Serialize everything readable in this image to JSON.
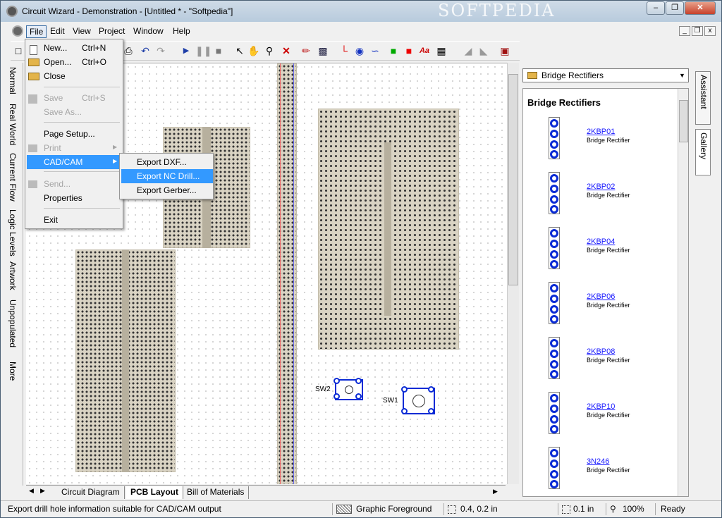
{
  "window": {
    "title": "Circuit Wizard - Demonstration - [Untitled * - \"Softpedia\"]",
    "watermark": "SOFTPEDIA"
  },
  "menubar": [
    "File",
    "Edit",
    "View",
    "Project",
    "Window",
    "Help"
  ],
  "file_menu": {
    "new": "New...",
    "new_sc": "Ctrl+N",
    "open": "Open...",
    "open_sc": "Ctrl+O",
    "close": "Close",
    "save": "Save",
    "save_sc": "Ctrl+S",
    "save_as": "Save As...",
    "page_setup": "Page Setup...",
    "print": "Print",
    "cadcam": "CAD/CAM",
    "send": "Send...",
    "properties": "Properties",
    "exit": "Exit"
  },
  "cadcam_menu": {
    "export_dxf": "Export DXF...",
    "export_nc_drill": "Export NC Drill...",
    "export_gerber": "Export Gerber..."
  },
  "side_tabs": [
    "Normal",
    "Real World",
    "Current Flow",
    "Logic Levels",
    "Artwork",
    "Unpopulated",
    "More"
  ],
  "canvas": {
    "sw1": "SW1",
    "sw2": "SW2"
  },
  "doc_tabs": [
    "Circuit Diagram",
    "PCB Layout",
    "Bill of Materials"
  ],
  "gallery": {
    "combo_value": "Bridge Rectifiers",
    "heading": "Bridge Rectifiers",
    "items": [
      {
        "name": "2KBP01",
        "desc": "Bridge Rectifier"
      },
      {
        "name": "2KBP02",
        "desc": "Bridge Rectifier"
      },
      {
        "name": "2KBP04",
        "desc": "Bridge Rectifier"
      },
      {
        "name": "2KBP06",
        "desc": "Bridge Rectifier"
      },
      {
        "name": "2KBP08",
        "desc": "Bridge Rectifier"
      },
      {
        "name": "2KBP10",
        "desc": "Bridge Rectifier"
      },
      {
        "name": "3N246",
        "desc": "Bridge Rectifier"
      }
    ]
  },
  "right_tabs": [
    "Assistant",
    "Gallery"
  ],
  "statusbar": {
    "message": "Export drill hole information suitable for CAD/CAM output",
    "layer": "Graphic Foreground",
    "coords": "0.4, 0.2 in",
    "grid": "0.1 in",
    "zoom": "100%",
    "state": "Ready"
  }
}
